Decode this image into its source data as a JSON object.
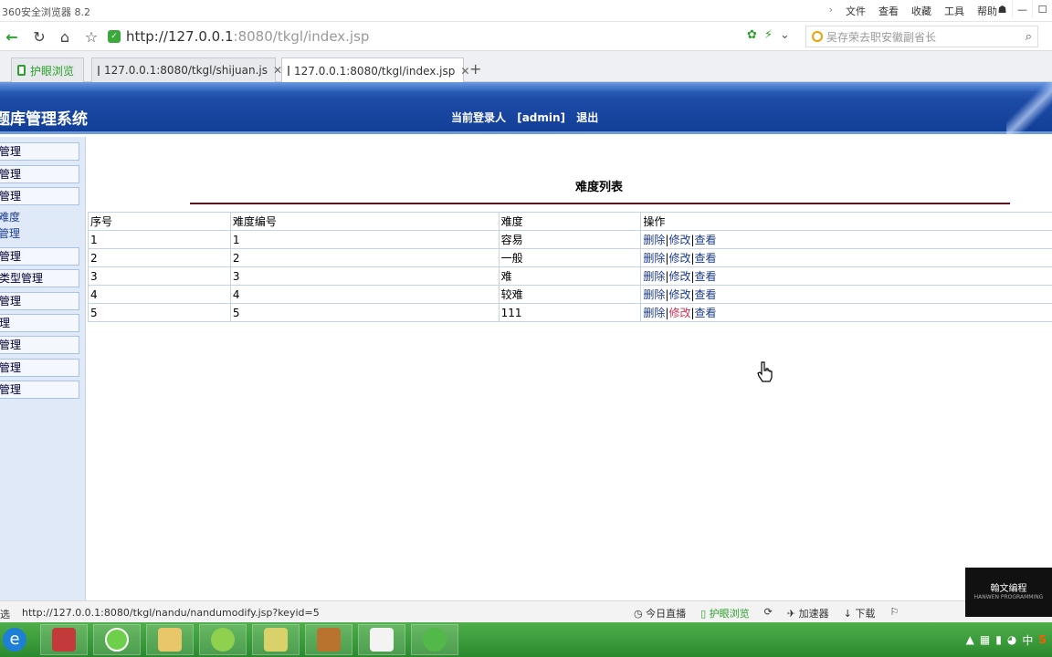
{
  "browser": {
    "title": "360安全浏览器 8.2",
    "menu": [
      "文件",
      "查看",
      "收藏",
      "工具",
      "帮助"
    ],
    "url_host": "http://127.0.0.1",
    "url_rest": ":8080/tkgl/index.jsp",
    "search_placeholder": "吴存荣去职安徽副省长",
    "tabs": [
      {
        "label": "护眼浏览"
      },
      {
        "label": "127.0.0.1:8080/tkgl/shijuan.js"
      },
      {
        "label": "127.0.0.1:8080/tkgl/index.jsp"
      }
    ],
    "new_tab": "+"
  },
  "header": {
    "system_title": "题库管理系统",
    "login_label": "当前登录人",
    "login_user": "[admin]",
    "logout": "退出"
  },
  "sidebar": {
    "items": [
      "管理",
      "管理",
      "管理",
      "难度",
      "管理",
      "管理",
      "类型管理",
      "管理",
      "理",
      "管理",
      "管理",
      "管理"
    ]
  },
  "main": {
    "list_title": "难度列表",
    "columns": [
      "序号",
      "难度编号",
      "难度",
      "操作"
    ],
    "rows": [
      {
        "seq": "1",
        "code": "1",
        "level": "容易"
      },
      {
        "seq": "2",
        "code": "2",
        "level": "一般"
      },
      {
        "seq": "3",
        "code": "3",
        "level": "难"
      },
      {
        "seq": "4",
        "code": "4",
        "level": "较难"
      },
      {
        "seq": "5",
        "code": "5",
        "level": "111"
      }
    ],
    "op_delete": "删除",
    "op_edit": "修改",
    "op_view": "查看",
    "op_sep": "|"
  },
  "status": {
    "left": "选",
    "link": "http://127.0.0.1:8080/tkgl/nandu/nandumodify.jsp?keyid=5",
    "items": [
      "今日直播",
      "护眼浏览",
      "加速器",
      "下载"
    ]
  },
  "watermark": {
    "line1": "翰文编程",
    "line2": "HANWEN PROGRAMMING"
  },
  "tray": {
    "ime": "中",
    "s_icon": "S"
  },
  "colors": {
    "header_blue": "#123f97",
    "link_blue": "#1d3b8f",
    "hover_red": "#d03050",
    "rule": "#5b1222",
    "taskbar_green": "#2b8a2e"
  }
}
